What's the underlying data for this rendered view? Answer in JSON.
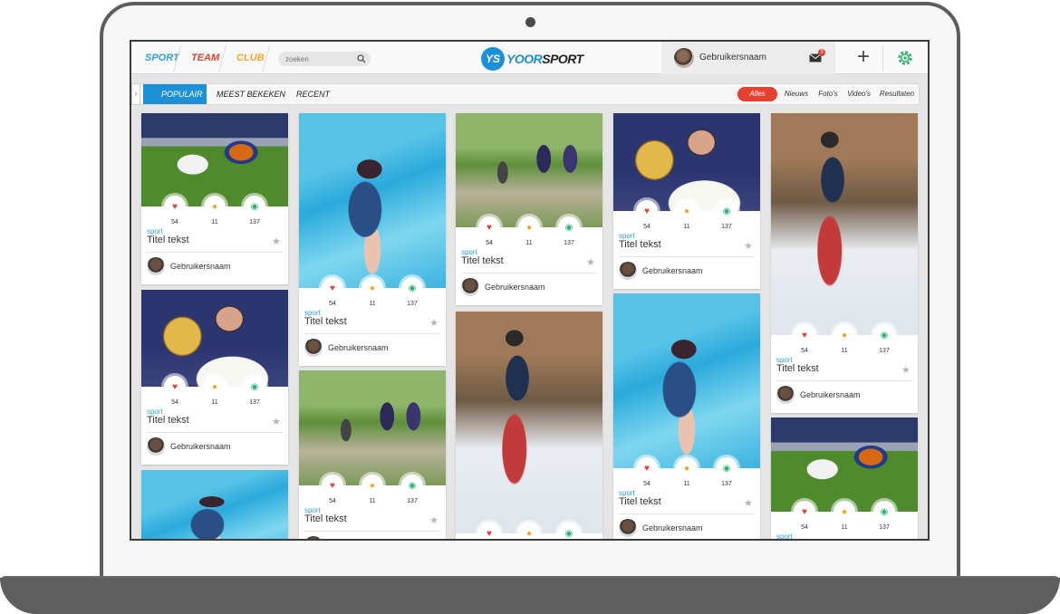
{
  "nav": {
    "tabs": [
      {
        "label": "SPORT",
        "color": "#2ea0d8"
      },
      {
        "label": "TEAM",
        "color": "#e8402f"
      },
      {
        "label": "CLUB",
        "color": "#f5a623"
      }
    ],
    "search_placeholder": "zoeken"
  },
  "logo": {
    "badge": "YS",
    "part1": "YOOR",
    "part2": "SPORT",
    "color1": "#1c8fd9",
    "color2": "#f0822a"
  },
  "user": {
    "name": "Gebruikersnaam",
    "mail_count": "3"
  },
  "sort_tabs": [
    "POPULAIR",
    "MEEST BEKEKEN",
    "RECENT"
  ],
  "filters": [
    "Alles",
    "Nieuws",
    "Foto's",
    "Video's",
    "Resultaten"
  ],
  "card": {
    "likes": "54",
    "comments": "11",
    "views": "137",
    "category": "sport",
    "title": "Titel tekst",
    "author": "Gebruikersnaam"
  },
  "colors": {
    "like": "#e8402f",
    "comment": "#f5a623",
    "view": "#2ab56f",
    "accent": "#1d90d8"
  }
}
